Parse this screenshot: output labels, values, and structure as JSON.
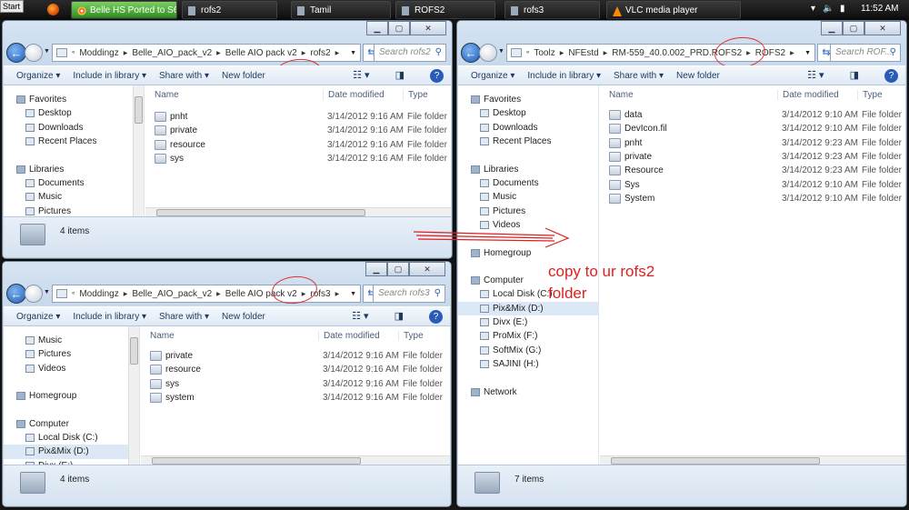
{
  "taskbar": {
    "start_label": "Start",
    "tasks": [
      {
        "label": "Belle HS Ported to S6...",
        "active": true,
        "icon": "chrome-icon"
      },
      {
        "label": "rofs2",
        "icon": "folder-icon"
      },
      {
        "label": "Tamil",
        "icon": "folder-icon"
      },
      {
        "label": "ROFS2",
        "icon": "folder-icon"
      },
      {
        "label": "rofs3",
        "icon": "folder-icon"
      },
      {
        "label": "VLC media player",
        "icon": "vlc-icon"
      }
    ],
    "clock": "11:52 AM"
  },
  "windows": [
    {
      "id": "rofs2",
      "breadcrumb": [
        "Moddingz",
        "Belle_AIO_pack_v2",
        "Belle AIO pack v2",
        "rofs2"
      ],
      "search_placeholder": "Search rofs2",
      "toolbar": [
        "Organize ▾",
        "Include in library ▾",
        "Share with ▾",
        "New folder"
      ],
      "columns": [
        "Name",
        "Date modified",
        "Type"
      ],
      "nav": [
        {
          "label": "Favorites",
          "header": true
        },
        {
          "label": "Desktop"
        },
        {
          "label": "Downloads"
        },
        {
          "label": "Recent Places"
        },
        {
          "label": "Libraries",
          "header": true
        },
        {
          "label": "Documents"
        },
        {
          "label": "Music"
        },
        {
          "label": "Pictures"
        }
      ],
      "files": [
        {
          "name": "pnht",
          "date": "3/14/2012 9:16 AM",
          "type": "File folder"
        },
        {
          "name": "private",
          "date": "3/14/2012 9:16 AM",
          "type": "File folder"
        },
        {
          "name": "resource",
          "date": "3/14/2012 9:16 AM",
          "type": "File folder"
        },
        {
          "name": "sys",
          "date": "3/14/2012 9:16 AM",
          "type": "File folder"
        }
      ],
      "status": "4 items"
    },
    {
      "id": "ROFS2",
      "breadcrumb": [
        "Toolz",
        "NFEstd",
        "RM-559_40.0.002_PRD.ROFS2",
        "ROFS2"
      ],
      "search_placeholder": "Search ROF...",
      "toolbar": [
        "Organize ▾",
        "Include in library ▾",
        "Share with ▾",
        "New folder"
      ],
      "columns": [
        "Name",
        "Date modified",
        "Type"
      ],
      "nav": [
        {
          "label": "Favorites",
          "header": true
        },
        {
          "label": "Desktop"
        },
        {
          "label": "Downloads"
        },
        {
          "label": "Recent Places"
        },
        {
          "label": "Libraries",
          "header": true
        },
        {
          "label": "Documents"
        },
        {
          "label": "Music"
        },
        {
          "label": "Pictures"
        },
        {
          "label": "Videos"
        },
        {
          "label": "Homegroup",
          "header": true
        },
        {
          "label": "Computer",
          "header": true
        },
        {
          "label": "Local Disk (C:)"
        },
        {
          "label": "Pix&Mix (D:)",
          "selected": true
        },
        {
          "label": "Divx (E:)"
        },
        {
          "label": "ProMix (F:)"
        },
        {
          "label": "SoftMix (G:)"
        },
        {
          "label": "SAJINI (H:)"
        },
        {
          "label": "Network",
          "header": true
        }
      ],
      "files": [
        {
          "name": "data",
          "date": "3/14/2012 9:10 AM",
          "type": "File folder"
        },
        {
          "name": "DevIcon.fil",
          "date": "3/14/2012 9:10 AM",
          "type": "File folder"
        },
        {
          "name": "pnht",
          "date": "3/14/2012 9:23 AM",
          "type": "File folder"
        },
        {
          "name": "private",
          "date": "3/14/2012 9:23 AM",
          "type": "File folder"
        },
        {
          "name": "Resource",
          "date": "3/14/2012 9:23 AM",
          "type": "File folder"
        },
        {
          "name": "Sys",
          "date": "3/14/2012 9:10 AM",
          "type": "File folder"
        },
        {
          "name": "System",
          "date": "3/14/2012 9:10 AM",
          "type": "File folder"
        }
      ],
      "status": "7 items"
    },
    {
      "id": "rofs3",
      "breadcrumb": [
        "Moddingz",
        "Belle_AIO_pack_v2",
        "Belle AIO pack v2",
        "rofs3"
      ],
      "search_placeholder": "Search rofs3",
      "toolbar": [
        "Organize ▾",
        "Include in library ▾",
        "Share with ▾",
        "New folder"
      ],
      "columns": [
        "Name",
        "Date modified",
        "Type"
      ],
      "nav": [
        {
          "label": "Music"
        },
        {
          "label": "Pictures"
        },
        {
          "label": "Videos"
        },
        {
          "label": "Homegroup",
          "header": true
        },
        {
          "label": "Computer",
          "header": true
        },
        {
          "label": "Local Disk (C:)"
        },
        {
          "label": "Pix&Mix (D:)",
          "selected": true
        },
        {
          "label": "Divx (E:)"
        }
      ],
      "files": [
        {
          "name": "private",
          "date": "3/14/2012 9:16 AM",
          "type": "File folder"
        },
        {
          "name": "resource",
          "date": "3/14/2012 9:16 AM",
          "type": "File folder"
        },
        {
          "name": "sys",
          "date": "3/14/2012 9:16 AM",
          "type": "File folder"
        },
        {
          "name": "system",
          "date": "3/14/2012 9:16 AM",
          "type": "File folder"
        }
      ],
      "status": "4 items"
    }
  ],
  "annotation": {
    "text": "copy to ur rofs2 folder",
    "color": "#e02020"
  }
}
